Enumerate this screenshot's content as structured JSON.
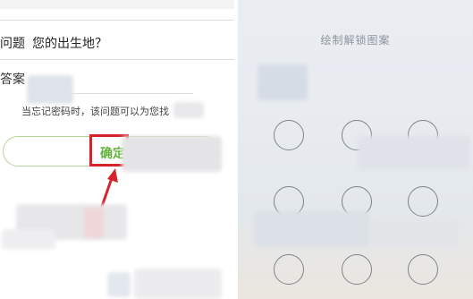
{
  "security_question": {
    "question_label": "问题",
    "question_text": "您的出生地？",
    "answer_label": "答案",
    "answer_value": "",
    "hint": "当忘记密码时，该问题可以为您找",
    "confirm_button": "确定"
  },
  "unlock_pattern": {
    "title": "绘制解锁图案",
    "dots": [
      "",
      "",
      "",
      "",
      "",
      "",
      "",
      "",
      ""
    ]
  },
  "colors": {
    "confirm_green": "#62b33a",
    "button_border": "#b9d39a",
    "highlight_red": "#d6242c"
  },
  "icons": [
    "annotation-arrow-icon"
  ]
}
